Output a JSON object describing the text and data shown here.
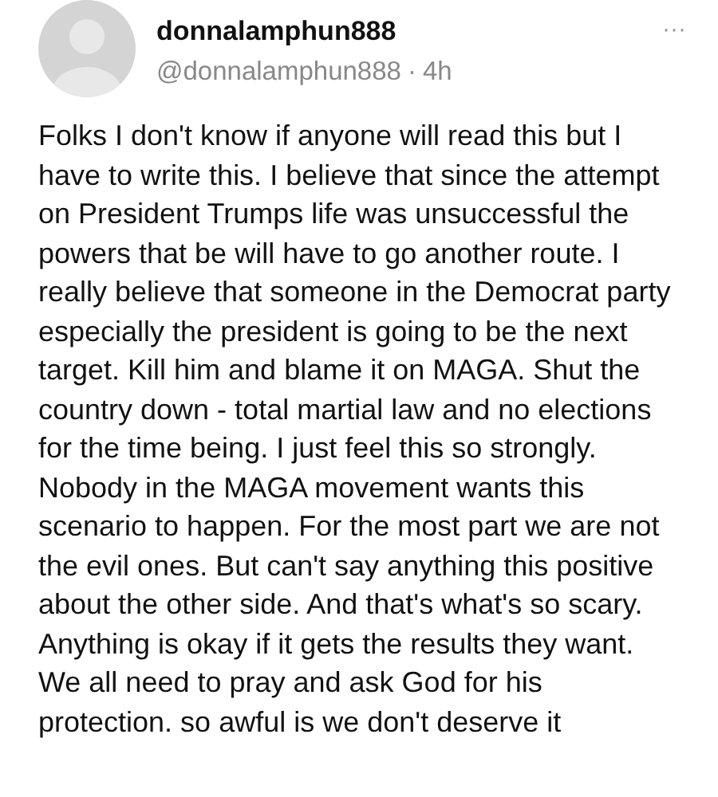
{
  "post": {
    "display_name": "donnalamphun888",
    "handle": "@donnalamphun888",
    "separator": "·",
    "time": "4h",
    "more": "···",
    "body": "Folks I don't know if anyone will read this but I have to write this. I believe that since the attempt on President Trumps life was unsuccessful the powers that be will have to go another route. I really believe that someone in the Democrat party especially the president is going to be the next target. Kill him and blame it on MAGA. Shut the country down - total martial law and no elections for the time being. I just feel this so strongly. Nobody in the MAGA movement wants this scenario to happen. For the most part we are not the evil ones. But can't say anything this positive about the other side. And that's what's so scary. Anything is okay if it gets the results they want. We all need to pray and ask God for his protection. so awful is we don't deserve it"
  }
}
